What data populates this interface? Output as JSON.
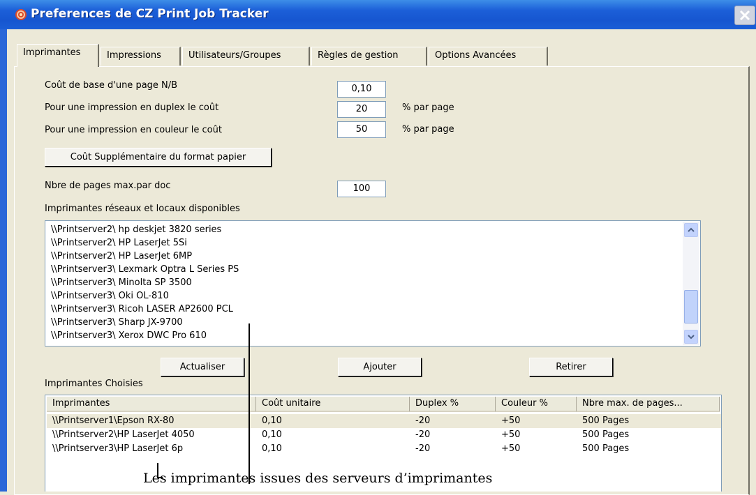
{
  "window": {
    "title": "Preferences de CZ Print Job Tracker",
    "icon": "app-icon",
    "close_icon": "close-icon"
  },
  "tabs": [
    {
      "label": "Imprimantes",
      "active": true
    },
    {
      "label": "Impressions",
      "active": false
    },
    {
      "label": "Utilisateurs/Groupes",
      "active": false
    },
    {
      "label": "Règles de gestion",
      "active": false
    },
    {
      "label": "Options Avancées",
      "active": false
    }
  ],
  "settings": {
    "base_cost_label": "Coût de base d'une page N/B",
    "base_cost_value": "0,10",
    "duplex_label": "Pour une impression en duplex le coût",
    "duplex_value": "20",
    "duplex_unit": "% par page",
    "color_label": "Pour une impression en couleur le coût",
    "color_value": "50",
    "color_unit": "% par page",
    "paper_format_button": "Coût Supplémentaire du format papier",
    "max_pages_label": "Nbre de pages max.par doc",
    "max_pages_value": "100"
  },
  "available": {
    "label": "Imprimantes réseaux et locaux disponibles",
    "items": [
      "\\\\Printserver2\\ hp deskjet 3820 series",
      "\\\\Printserver2\\ HP LaserJet 5Si",
      "\\\\Printserver2\\ HP LaserJet 6MP",
      "\\\\Printserver3\\ Lexmark Optra L Series PS",
      "\\\\Printserver3\\ Minolta SP 3500",
      "\\\\Printserver3\\ Oki OL-810",
      "\\\\Printserver3\\ Ricoh LASER AP2600 PCL",
      "\\\\Printserver3\\ Sharp JX-9700",
      "\\\\Printserver3\\ Xerox DWC Pro 610"
    ]
  },
  "actions": {
    "refresh": "Actualiser",
    "add": "Ajouter",
    "remove": "Retirer"
  },
  "chosen": {
    "label": "Imprimantes Choisies",
    "columns": [
      "Imprimantes",
      "Coût unitaire",
      "Duplex %",
      "Couleur %",
      "Nbre max. de pages..."
    ],
    "rows": [
      {
        "printer": "\\\\Printserver1\\Epson RX-80",
        "unit_cost": "0,10",
        "duplex": "-20",
        "color": "+50",
        "max_pages": "500 Pages",
        "selected": true
      },
      {
        "printer": "\\\\Printserver2\\HP LaserJet 4050",
        "unit_cost": "0,10",
        "duplex": "-20",
        "color": "+50",
        "max_pages": "500 Pages",
        "selected": false
      },
      {
        "printer": "\\\\Printserver3\\HP LaserJet 6p",
        "unit_cost": "0,10",
        "duplex": "-20",
        "color": "+50",
        "max_pages": "500 Pages",
        "selected": false
      }
    ]
  },
  "annotation": {
    "caption": "Les imprimantes issues des serveurs d’imprimantes"
  },
  "colors": {
    "titlebar": "#1c5fd8",
    "window_bg": "#ece9d8",
    "selected_row": "#ece9d8"
  }
}
